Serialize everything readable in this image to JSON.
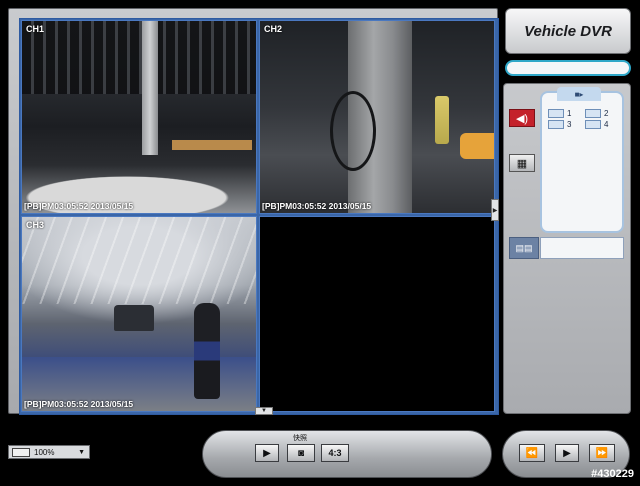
{
  "brand": {
    "title": "Vehicle DVR"
  },
  "channels": [
    {
      "label": "CH1",
      "stamp": "[PB]PM03:05:52 2013/05/15"
    },
    {
      "label": "CH2",
      "stamp": "[PB]PM03:05:52 2013/05/15"
    },
    {
      "label": "CH3",
      "stamp": "[PB]PM03:05:52 2013/05/15"
    },
    {
      "label": "",
      "stamp": ""
    }
  ],
  "side_panel": {
    "channel_list": [
      "1",
      "2",
      "3",
      "4"
    ]
  },
  "zoom": {
    "value": "100%"
  },
  "playback": {
    "play_icon": "▶",
    "snapshot_caption": "快照",
    "snapshot_icon": "camera-icon",
    "aspect_label": "4:3"
  },
  "navigation": {
    "prev_icon": "⏪",
    "play_icon": "▶",
    "next_icon": "⏩"
  },
  "watermark": "#430229",
  "colors": {
    "accent_blue": "#2e5aa0",
    "audio_red": "#c4212a",
    "status_cyan": "#2fa7c8"
  }
}
